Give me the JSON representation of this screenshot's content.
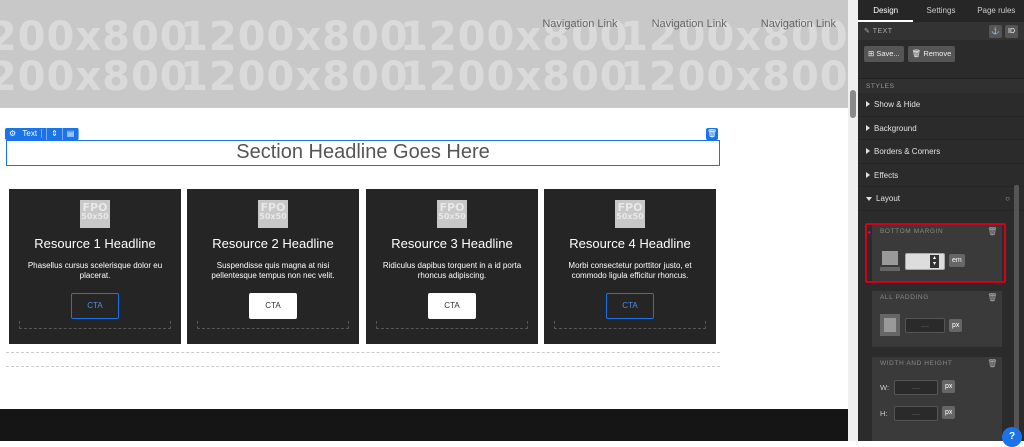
{
  "canvas": {
    "placeholder_text": "1200x800",
    "nav_links": [
      "Navigation Link",
      "Navigation Link",
      "Navigation Link"
    ],
    "selection_tab": {
      "label": "Text"
    },
    "section_headline": "Section Headline Goes Here",
    "cards": [
      {
        "fpo_top": "FPO",
        "fpo_bottom": "50x50",
        "title": "Resource 1 Headline",
        "body": "Phasellus cursus scelerisque dolor eu placerat.",
        "cta": "CTA",
        "cta_style": "outline"
      },
      {
        "fpo_top": "FPO",
        "fpo_bottom": "50x50",
        "title": "Resource 2 Headline",
        "body": "Suspendisse quis magna at nisi pellentesque tempus non nec velit.",
        "cta": "CTA",
        "cta_style": "filled"
      },
      {
        "fpo_top": "FPO",
        "fpo_bottom": "50x50",
        "title": "Resource 3 Headline",
        "body": "Ridiculus dapibus torquent in a id porta rhoncus adipiscing.",
        "cta": "CTA",
        "cta_style": "filled"
      },
      {
        "fpo_top": "FPO",
        "fpo_bottom": "50x50",
        "title": "Resource 4 Headline",
        "body": "Morbi consectetur porttitor justo, et commodo ligula efficitur rhoncus.",
        "cta": "CTA",
        "cta_style": "outline"
      }
    ]
  },
  "panel": {
    "tabs": [
      "Design",
      "Settings",
      "Page rules"
    ],
    "active_tab": "Design",
    "element_type": "TEXT",
    "id_label": "ID",
    "save_label": "Save...",
    "remove_label": "Remove",
    "styles_header": "STYLES",
    "groups": [
      "Show & Hide",
      "Background",
      "Borders & Corners",
      "Effects",
      "Layout"
    ],
    "bottom_margin": {
      "header": "BOTTOM MARGIN",
      "value": "",
      "unit": "em"
    },
    "all_padding": {
      "header": "ALL PADDING",
      "placeholder": "....",
      "unit": "px"
    },
    "width_height": {
      "header": "WIDTH AND HEIGHT",
      "w_label": "W:",
      "h_label": "H:",
      "placeholder": "....",
      "unit": "px"
    },
    "help_label": "?"
  },
  "colors": {
    "accent": "#1a73e8",
    "highlight": "#d0021b",
    "panel_bg": "#2b2b2b",
    "card_bg": "#252525"
  }
}
